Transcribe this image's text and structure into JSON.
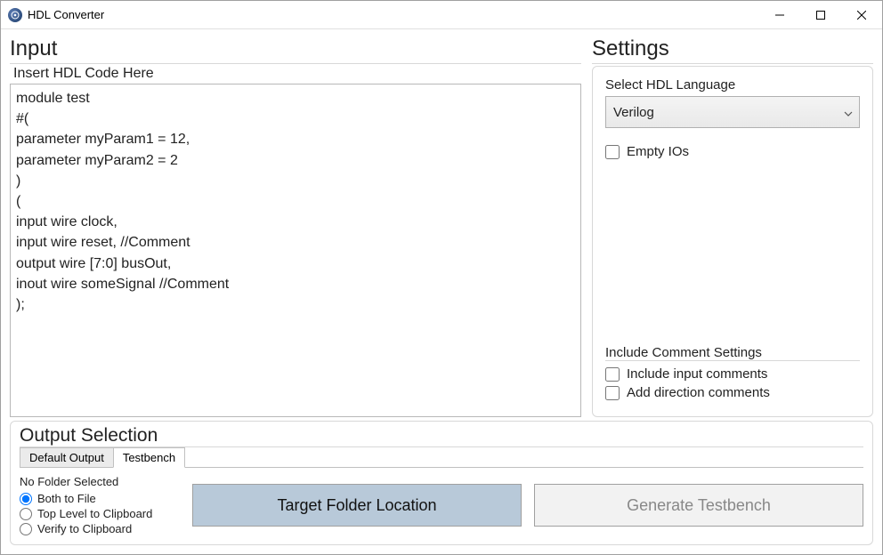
{
  "window": {
    "title": "HDL Converter"
  },
  "input": {
    "panel_title": "Input",
    "label": "Insert HDL Code Here",
    "code": "module test\n#(\nparameter myParam1 = 12,\nparameter myParam2 = 2\n)\n(\ninput wire clock,\ninput wire reset, //Comment\noutput wire [7:0] busOut,\ninout wire someSignal //Comment\n);"
  },
  "settings": {
    "panel_title": "Settings",
    "language_label": "Select HDL Language",
    "language_value": "Verilog",
    "empty_ios_label": "Empty IOs",
    "empty_ios_checked": false,
    "comment_group_title": "Include Comment Settings",
    "include_input_comments_label": "Include input comments",
    "include_input_comments_checked": false,
    "add_direction_comments_label": "Add direction comments",
    "add_direction_comments_checked": false
  },
  "output": {
    "panel_title": "Output Selection",
    "tabs": [
      {
        "label": "Default Output",
        "active": false
      },
      {
        "label": "Testbench",
        "active": true
      }
    ],
    "folder_status": "No Folder Selected",
    "radios": [
      {
        "label": "Both to File",
        "checked": true
      },
      {
        "label": "Top Level to Clipboard",
        "checked": false
      },
      {
        "label": "Verify to Clipboard",
        "checked": false
      }
    ],
    "target_button": "Target Folder Location",
    "generate_button": "Generate Testbench"
  }
}
